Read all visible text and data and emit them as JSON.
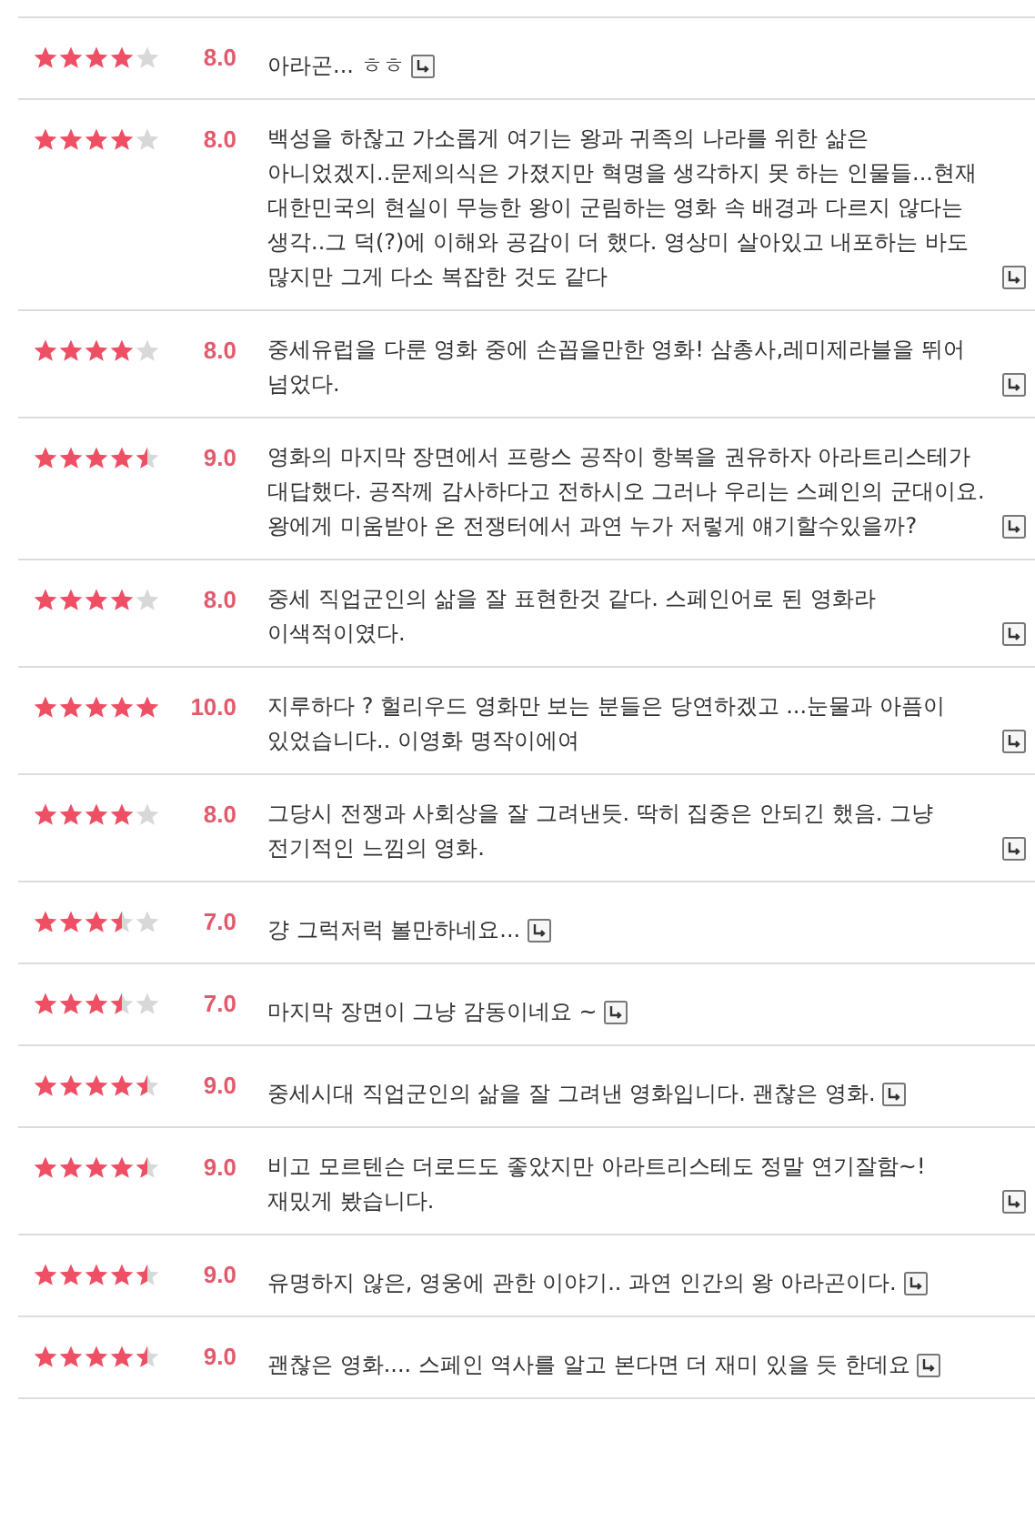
{
  "reviews": [
    {
      "stars": 4,
      "score": "8.0",
      "comment": "아라곤... ㅎㅎ"
    },
    {
      "stars": 4,
      "score": "8.0",
      "comment": "백성을 하찮고 가소롭게 여기는 왕과 귀족의 나라를 위한 삶은 아니었겠지..문제의식은 가졌지만 혁명을 생각하지 못 하는 인물들...현재 대한민국의 현실이 무능한 왕이 군림하는 영화 속 배경과 다르지 않다는 생각..그 덕(?)에 이해와 공감이 더 했다. 영상미 살아있고 내포하는 바도 많지만 그게 다소 복잡한 것도 같다"
    },
    {
      "stars": 4,
      "score": "8.0",
      "comment": "중세유럽을 다룬 영화 중에 손꼽을만한 영화! 삼총사,레미제라블을 뛰어 넘었다."
    },
    {
      "stars": 4.5,
      "score": "9.0",
      "comment": "영화의 마지막 장면에서 프랑스 공작이 항복을 권유하자 아라트리스테가 대답했다. 공작께 감사하다고 전하시오 그러나 우리는 스페인의 군대이요. 왕에게 미움받아 온 전쟁터에서 과연 누가 저렇게 얘기할수있을까?"
    },
    {
      "stars": 4,
      "score": "8.0",
      "comment": "중세 직업군인의 삶을 잘 표현한것 같다. 스페인어로 된 영화라 이색적이였다."
    },
    {
      "stars": 5,
      "score": "10.0",
      "comment": "지루하다 ? 헐리우드 영화만 보는 분들은 당연하겠고 ...눈물과 아픔이 있었습니다.. 이영화 명작이에여"
    },
    {
      "stars": 4,
      "score": "8.0",
      "comment": "그당시 전쟁과 사회상을 잘 그려낸듯. 딱히 집중은 안되긴 했음. 그냥 전기적인 느낌의 영화."
    },
    {
      "stars": 3.5,
      "score": "7.0",
      "comment": "걍 그럭저럭 볼만하네요..."
    },
    {
      "stars": 3.5,
      "score": "7.0",
      "comment": "마지막 장면이 그냥 감동이네요 ~"
    },
    {
      "stars": 4.5,
      "score": "9.0",
      "comment": "중세시대 직업군인의 삶을 잘 그려낸 영화입니다. 괜찮은 영화."
    },
    {
      "stars": 4.5,
      "score": "9.0",
      "comment": "비고 모르텐슨 더로드도 좋았지만 아라트리스테도 정말 연기잘함~! 재밌게 봤습니다."
    },
    {
      "stars": 4.5,
      "score": "9.0",
      "comment": "유명하지 않은, 영웅에 관한 이야기.. 과연 인간의 왕 아라곤이다."
    },
    {
      "stars": 4.5,
      "score": "9.0",
      "comment": "괜찮은 영화.... 스페인 역사를 알고 본다면 더 재미 있을 듯 한데요"
    }
  ]
}
